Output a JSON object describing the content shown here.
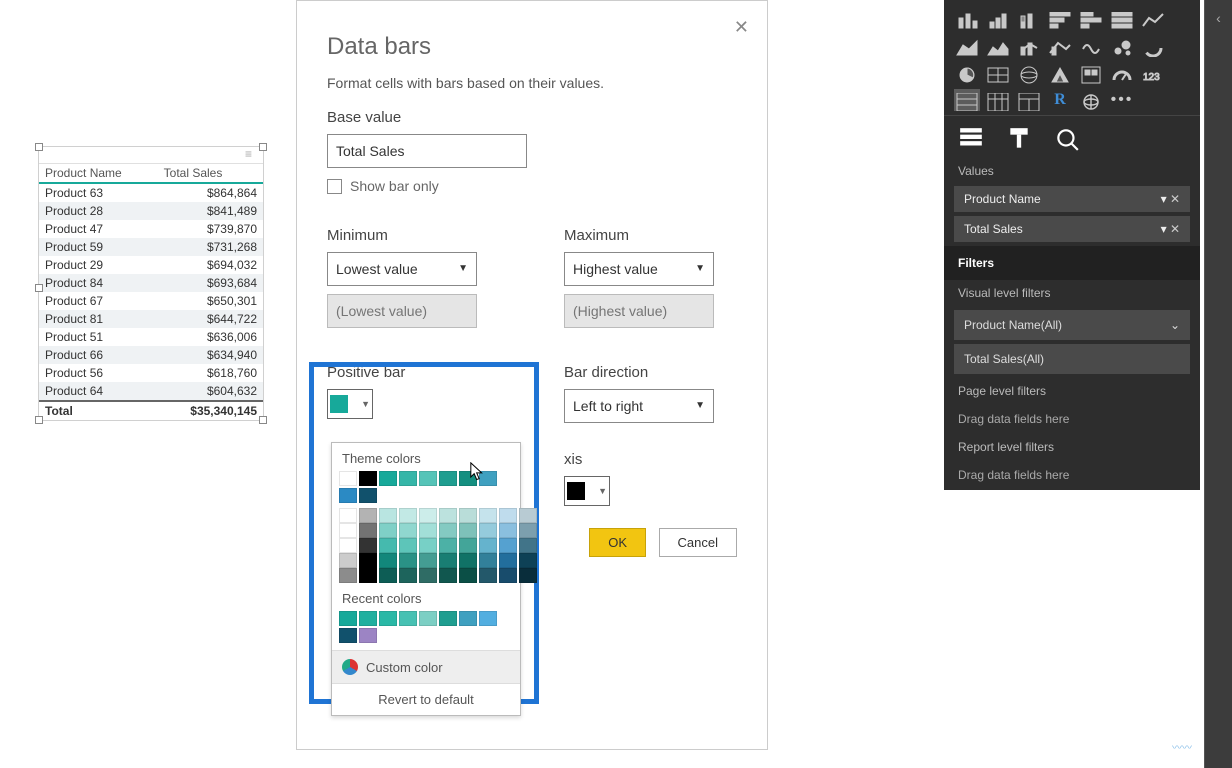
{
  "table": {
    "col1": "Product Name",
    "col2": "Total Sales",
    "rows": [
      {
        "name": "Product 63",
        "sales": "$864,864"
      },
      {
        "name": "Product 28",
        "sales": "$841,489"
      },
      {
        "name": "Product 47",
        "sales": "$739,870"
      },
      {
        "name": "Product 59",
        "sales": "$731,268"
      },
      {
        "name": "Product 29",
        "sales": "$694,032"
      },
      {
        "name": "Product 84",
        "sales": "$693,684"
      },
      {
        "name": "Product 67",
        "sales": "$650,301"
      },
      {
        "name": "Product 81",
        "sales": "$644,722"
      },
      {
        "name": "Product 51",
        "sales": "$636,006"
      },
      {
        "name": "Product 66",
        "sales": "$634,940"
      },
      {
        "name": "Product 56",
        "sales": "$618,760"
      },
      {
        "name": "Product 64",
        "sales": "$604,632"
      }
    ],
    "total_label": "Total",
    "total_value": "$35,340,145"
  },
  "dialog": {
    "title": "Data bars",
    "description": "Format cells with bars based on their values.",
    "base_value_label": "Base value",
    "base_value": "Total Sales",
    "show_bar_only": "Show bar only",
    "minimum_label": "Minimum",
    "maximum_label": "Maximum",
    "minimum_mode": "Lowest value",
    "maximum_mode": "Highest value",
    "minimum_placeholder": "(Lowest value)",
    "maximum_placeholder": "(Highest value)",
    "positive_bar_label": "Positive bar",
    "bar_direction_label": "Bar direction",
    "bar_direction_value": "Left to right",
    "axis_label": "Axis",
    "axis_partial": "xis",
    "ok": "OK",
    "cancel": "Cancel"
  },
  "picker": {
    "theme_label": "Theme colors",
    "recent_label": "Recent colors",
    "custom": "Custom color",
    "revert": "Revert to default",
    "row1": [
      "#ffffff",
      "#000000",
      "#17a99a",
      "#35b6a8",
      "#55c4b8",
      "#1f9e90",
      "#148f80",
      "#3fa0c0",
      "#2b8ac4",
      "#11516c"
    ],
    "recent": [
      "#17a99a",
      "#1fb09f",
      "#29b8a6",
      "#47c1b3",
      "#7ccfc4",
      "#1f9e90",
      "#3fa0c0",
      "#52aee0",
      "#11516c",
      "#9c84c4"
    ]
  },
  "side": {
    "values_label": "Values",
    "field1": "Product Name",
    "field2": "Total Sales",
    "filters_label": "Filters",
    "visual_filters": "Visual level filters",
    "filter1": "Product Name(All)",
    "filter2": "Total Sales(All)",
    "page_filters": "Page level filters",
    "drag_hint": "Drag data fields here",
    "report_filters": "Report level filters"
  },
  "colors": {
    "positive_swatch": "#17a99a",
    "axis_swatch": "#000000"
  }
}
